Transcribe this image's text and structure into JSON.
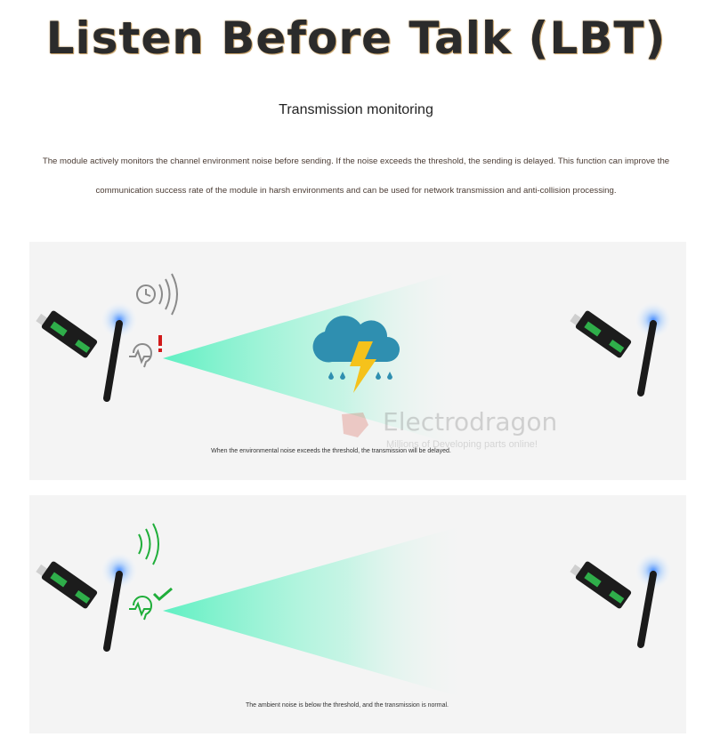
{
  "header": {
    "title": "Listen Before Talk (LBT)",
    "subtitle": "Transmission monitoring"
  },
  "description": {
    "line1": "The module actively monitors the channel environment noise before sending. If the noise exceeds the threshold, the sending is delayed. This function can improve the",
    "line2": "communication success rate of the module in harsh environments and can be used for network transmission and anti-collision processing."
  },
  "panels": [
    {
      "caption": "When the environmental noise exceeds the threshold, the transmission will be delayed.",
      "status": "delayed",
      "status_color": "#d11a1a"
    },
    {
      "caption": "The ambient noise is below the threshold, and the transmission is normal.",
      "status": "normal",
      "status_color": "#1fae3a"
    }
  ],
  "watermark": {
    "name": "Electrodragon",
    "tagline": "Millions of Developing parts online!"
  },
  "colors": {
    "beam": "#6ff0c6",
    "glow": "#7fb8ff",
    "storm_cloud": "#2f8fb0",
    "lightning": "#f5c21b"
  }
}
